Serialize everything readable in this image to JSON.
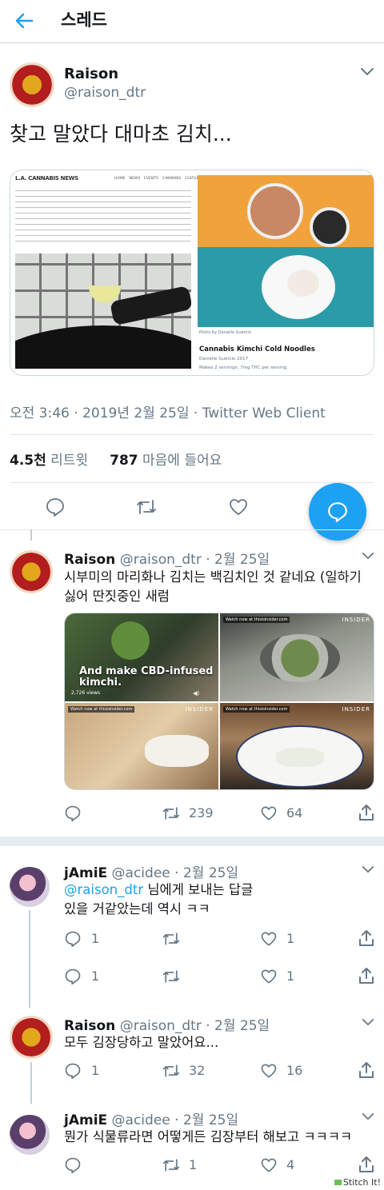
{
  "header": {
    "title": "스레드"
  },
  "main_tweet": {
    "name": "Raison",
    "handle": "@raison_dtr",
    "text": "찾고 말았다 대마초 김치...",
    "media": {
      "site_name": "L.A. CANNABIS NEWS",
      "nav": [
        "HOME",
        "NEWS",
        "EVENTS",
        "CANNABIS",
        "CULTURE"
      ],
      "photo_credit": "Photo by Danielle Guercio",
      "card_title": "Cannabis Kimchi Cold Noodles",
      "card_author": "Danielle Guercio 2017",
      "card_sub": "Makes 2 servings; 7mg THC per serving"
    },
    "meta": "오전 3:46 · 2019년 2월 25일 · Twitter Web Client",
    "retweets": "4.5천",
    "retweets_label": "리트윗",
    "likes": "787",
    "likes_label": "마음에 들어요"
  },
  "replies": [
    {
      "name": "Raison",
      "handle": "@raison_dtr",
      "date": "· 2월 25일",
      "text_line1": "시부미의 마리화나 김치는 백김치인 것 같네요 (일하기",
      "text_line2": "싫어 딴짓중인 새럼",
      "video_caption_1": "And make CBD-infused",
      "video_caption_2": "kimchi.",
      "insider": "INSIDER",
      "watch_label": "Watch now at thisisinsider.com",
      "view_count": "2,726 views",
      "retweets": "239",
      "likes": "64"
    },
    {
      "name": "jAmiE",
      "handle": "@acidee",
      "date": "· 2월 25일",
      "mention": "@raison_dtr",
      "text_after_mention": " 님에게 보내는 답글",
      "text_line2": "있을 거같았는데 역시 ㅋㅋ",
      "replies": "1",
      "likes": "1",
      "replies2": "1",
      "likes2": "1"
    },
    {
      "name": "Raison",
      "handle": "@raison_dtr",
      "date": "· 2월 25일",
      "text_line1": "모두 김장당하고 말았어요...",
      "replies": "1",
      "retweets": "32",
      "likes": "16"
    },
    {
      "name": "jAmiE",
      "handle": "@acidee",
      "date": "· 2월 25일",
      "text_line1": "뭔가 식물류라면 어떻게든 김장부터 해보고 ㅋㅋㅋㅋ",
      "retweets": "1",
      "likes": "4"
    }
  ],
  "footer": {
    "stitch": "Stitch It!"
  },
  "icons": {
    "back": "back-arrow-icon",
    "caret": "chevron-down-icon",
    "reply": "reply-icon",
    "retweet": "retweet-icon",
    "like": "heart-icon",
    "share": "share-icon",
    "compose": "compose-reply-icon"
  },
  "colors": {
    "accent": "#1da1f2",
    "muted": "#657786",
    "divider": "#e1e8ed"
  }
}
